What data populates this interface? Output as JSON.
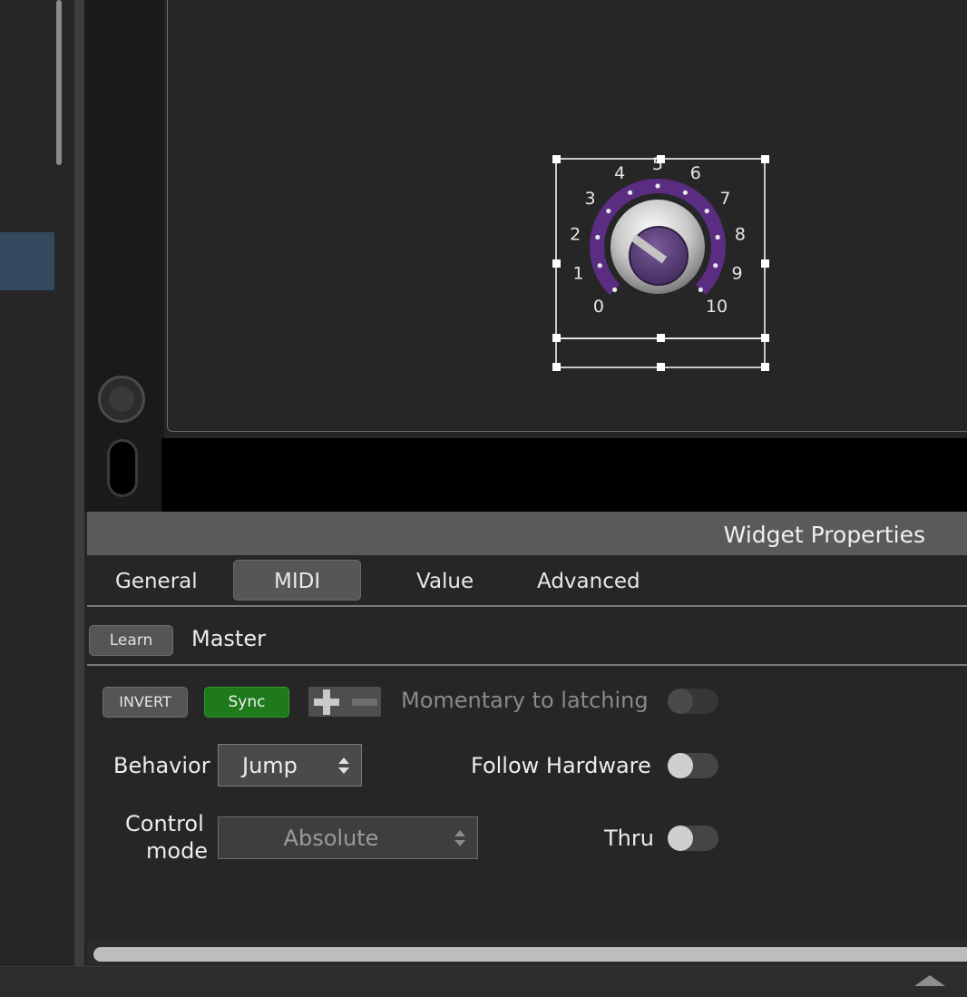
{
  "knob": {
    "scale_labels": [
      "0",
      "1",
      "2",
      "3",
      "4",
      "5",
      "6",
      "7",
      "8",
      "9",
      "10"
    ],
    "value": 0.3,
    "accent_color": "#5b2d82",
    "cap_color": "#5e3f7e"
  },
  "properties": {
    "title": "Widget Properties",
    "tabs": {
      "general": "General",
      "midi": "MIDI",
      "value": "Value",
      "advanced": "Advanced"
    },
    "active_tab": "MIDI",
    "learn_label": "Learn",
    "target_name": "Master",
    "invert_label": "INVERT",
    "sync_label": "Sync",
    "momentary_label": "Momentary to latching",
    "behavior_label": "Behavior",
    "behavior_value": "Jump",
    "follow_hardware_label": "Follow Hardware",
    "control_mode_label_line1": "Control",
    "control_mode_label_line2": "mode",
    "control_mode_value": "Absolute",
    "thru_label": "Thru",
    "sync_color": "#1f7a1c"
  },
  "icons": {
    "plus_minus": "plus-minus-icon",
    "updown": "updown-chevron-icon",
    "collapse": "collapse-up-icon"
  }
}
